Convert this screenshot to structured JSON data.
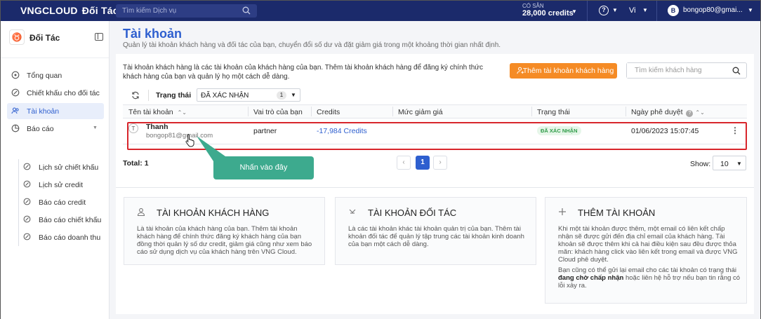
{
  "topbar": {
    "logo_vng": "VNG",
    "logo_cloud": "CLOUD",
    "logo_suffix": "Đối Tác",
    "search_placeholder": "Tìm kiếm Dịch vụ",
    "credit_label": "CÓ SẴN",
    "credit_value": "28,000 credits",
    "lang": "Vi",
    "user_initial": "B",
    "user_email": "bongop80@gmai..."
  },
  "sidebar": {
    "brand": "Đối Tác",
    "items": [
      {
        "label": "Tổng quan",
        "icon": "home-icon"
      },
      {
        "label": "Chiết khấu cho đối tác",
        "icon": "percent-icon"
      },
      {
        "label": "Tài khoản",
        "icon": "users-icon"
      },
      {
        "label": "Báo cáo",
        "icon": "chart-icon"
      }
    ],
    "subitems": [
      {
        "label": "Lịch sử chiết khấu",
        "icon": "percent-icon"
      },
      {
        "label": "Lịch sử credit",
        "icon": "percent-icon"
      },
      {
        "label": "Báo cáo credit",
        "icon": "percent-icon"
      },
      {
        "label": "Báo cáo chiết khấu",
        "icon": "percent-icon"
      },
      {
        "label": "Báo cáo doanh thu",
        "icon": "percent-icon"
      }
    ]
  },
  "page": {
    "title": "Tài khoản",
    "subtitle": "Quản lý tài khoản khách hàng và đối tác của bạn, chuyển đổi số dư và đặt giảm giá trong một khoảng thời gian nhất định.",
    "description": "Tài khoản khách hàng là các tài khoản của khách hàng của bạn. Thêm tài khoản khách hàng để đăng ký chính thức khách hàng của bạn và quản lý họ một cách dễ dàng.",
    "add_button": "Thêm tài khoản khách hàng",
    "search_placeholder": "Tìm kiếm khách hàng"
  },
  "toolbar": {
    "status_label": "Trạng thái",
    "status_value": "ĐÃ XÁC NHẬN",
    "status_count": "1"
  },
  "table": {
    "headers": [
      "Tên tài khoản",
      "Vai trò của bạn",
      "Credits",
      "Mức giảm giá",
      "Trạng thái",
      "Ngày phê duyệt"
    ],
    "rows": [
      {
        "initial": "T",
        "name": "Thanh",
        "email": "bongop81@gmail.com",
        "role": "partner",
        "credits": "-17,984 Credits",
        "discount": "",
        "status": "ĐÃ XÁC NHẬN",
        "approved": "01/06/2023 15:07:45"
      }
    ]
  },
  "footer": {
    "total": "Total: 1",
    "page_prev": "‹",
    "page_current": "1",
    "page_next": "›",
    "show_label": "Show:",
    "show_value": "10"
  },
  "callout": "Nhấn vào đây",
  "info_cards": [
    {
      "title": "TÀI KHOẢN KHÁCH HÀNG",
      "icon": "user-icon",
      "body": [
        "Là tài khoản của khách hàng của bạn. Thêm tài khoản",
        "khách hàng để chính thức đăng ký khách hàng của bạn",
        "đồng thời quản lý số dư credit, giảm giá cũng như xem báo",
        "cáo sử dụng dịch vụ của khách hàng trên VNG Cloud."
      ]
    },
    {
      "title": "TÀI KHOẢN ĐỐI TÁC",
      "icon": "partner-icon",
      "body": [
        "Là các tài khoản khác tài khoản quản trị của bạn. Thêm tài",
        "khoản đối tác để quản lý tập trung các tài khoản kinh doanh",
        "của bạn một cách dễ dàng."
      ]
    },
    {
      "title": "THÊM TÀI KHOẢN",
      "icon": "plus-icon",
      "body": [
        "Khi một tài khoản được thêm, một email có liên kết chấp",
        "nhận sẽ được gửi đến địa chỉ email của khách hàng. Tài",
        "khoản sẽ được thêm khi cả hai điều kiện sau đều được thỏa",
        "mãn: khách hàng click vào liên kết trong email và được VNG",
        "Cloud phê duyệt."
      ],
      "body2": [
        "Bạn cũng có thể gửi lại email cho các tài khoản có trạng thái"
      ],
      "body2_bold": "đang chờ chấp nhận",
      "body2_rest": " hoặc liên hệ hỗ trợ nếu bạn tin rằng có",
      "body2_last": "lỗi xảy ra."
    }
  ],
  "colors": {
    "brand": "#1b2a6b",
    "accent": "#2e5fcf",
    "orange": "#f58b25",
    "callout": "#3daa8e",
    "highlight": "#d8262c"
  }
}
